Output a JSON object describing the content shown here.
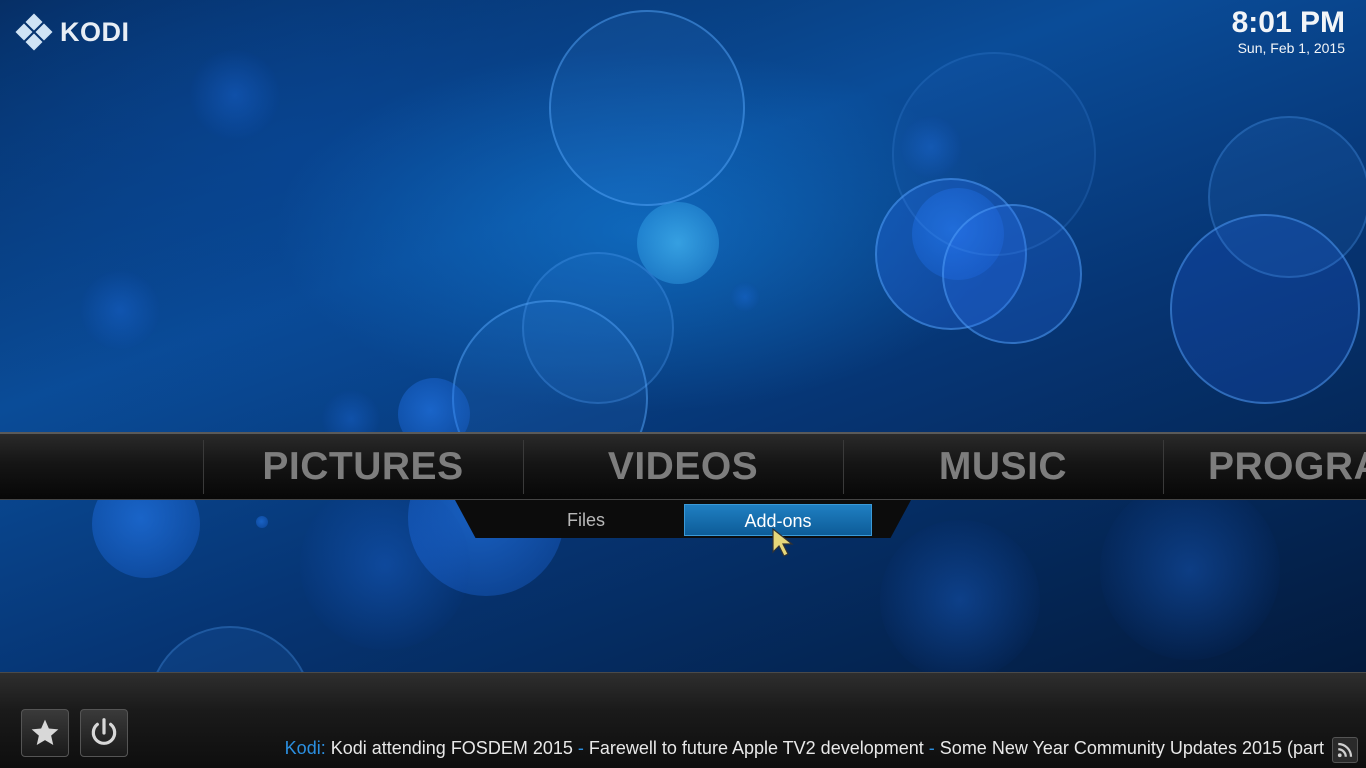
{
  "app": {
    "name": "KODI"
  },
  "clock": {
    "time": "8:01 PM",
    "date": "Sun, Feb 1, 2015"
  },
  "main_menu": {
    "items": [
      {
        "label": "PICTURES"
      },
      {
        "label": "VIDEOS"
      },
      {
        "label": "MUSIC"
      },
      {
        "label": "PROGRA"
      }
    ]
  },
  "submenu": {
    "items": [
      {
        "label": "Files"
      },
      {
        "label": "Add-ons",
        "selected": true
      }
    ]
  },
  "bottom": {
    "favourites_icon": "star-icon",
    "power_icon": "power-icon",
    "feed_icon": "rss-icon"
  },
  "ticker": {
    "source": "Kodi:",
    "items": [
      "Kodi attending FOSDEM 2015",
      "Farewell to future Apple TV2 development",
      "Some New Year Community Updates 2015 (part"
    ],
    "separator": "-"
  },
  "colors": {
    "accent": "#1f7fc2",
    "ticker_source": "#2b8fe0",
    "menu_text": "#7d7d7d"
  }
}
